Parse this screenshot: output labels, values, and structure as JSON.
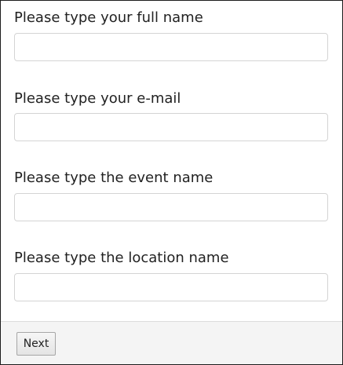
{
  "form": {
    "fields": [
      {
        "label": "Please type your full name",
        "value": "",
        "placeholder": ""
      },
      {
        "label": "Please type your e-mail",
        "value": "",
        "placeholder": ""
      },
      {
        "label": "Please type the event name",
        "value": "",
        "placeholder": ""
      },
      {
        "label": "Please type the location name",
        "value": "",
        "placeholder": ""
      }
    ]
  },
  "footer": {
    "next_label": "Next"
  },
  "colors": {
    "label_text": "#222222",
    "input_border": "#d4d4d4",
    "footer_background": "#f4f4f4",
    "window_border": "#1c1c1c"
  }
}
